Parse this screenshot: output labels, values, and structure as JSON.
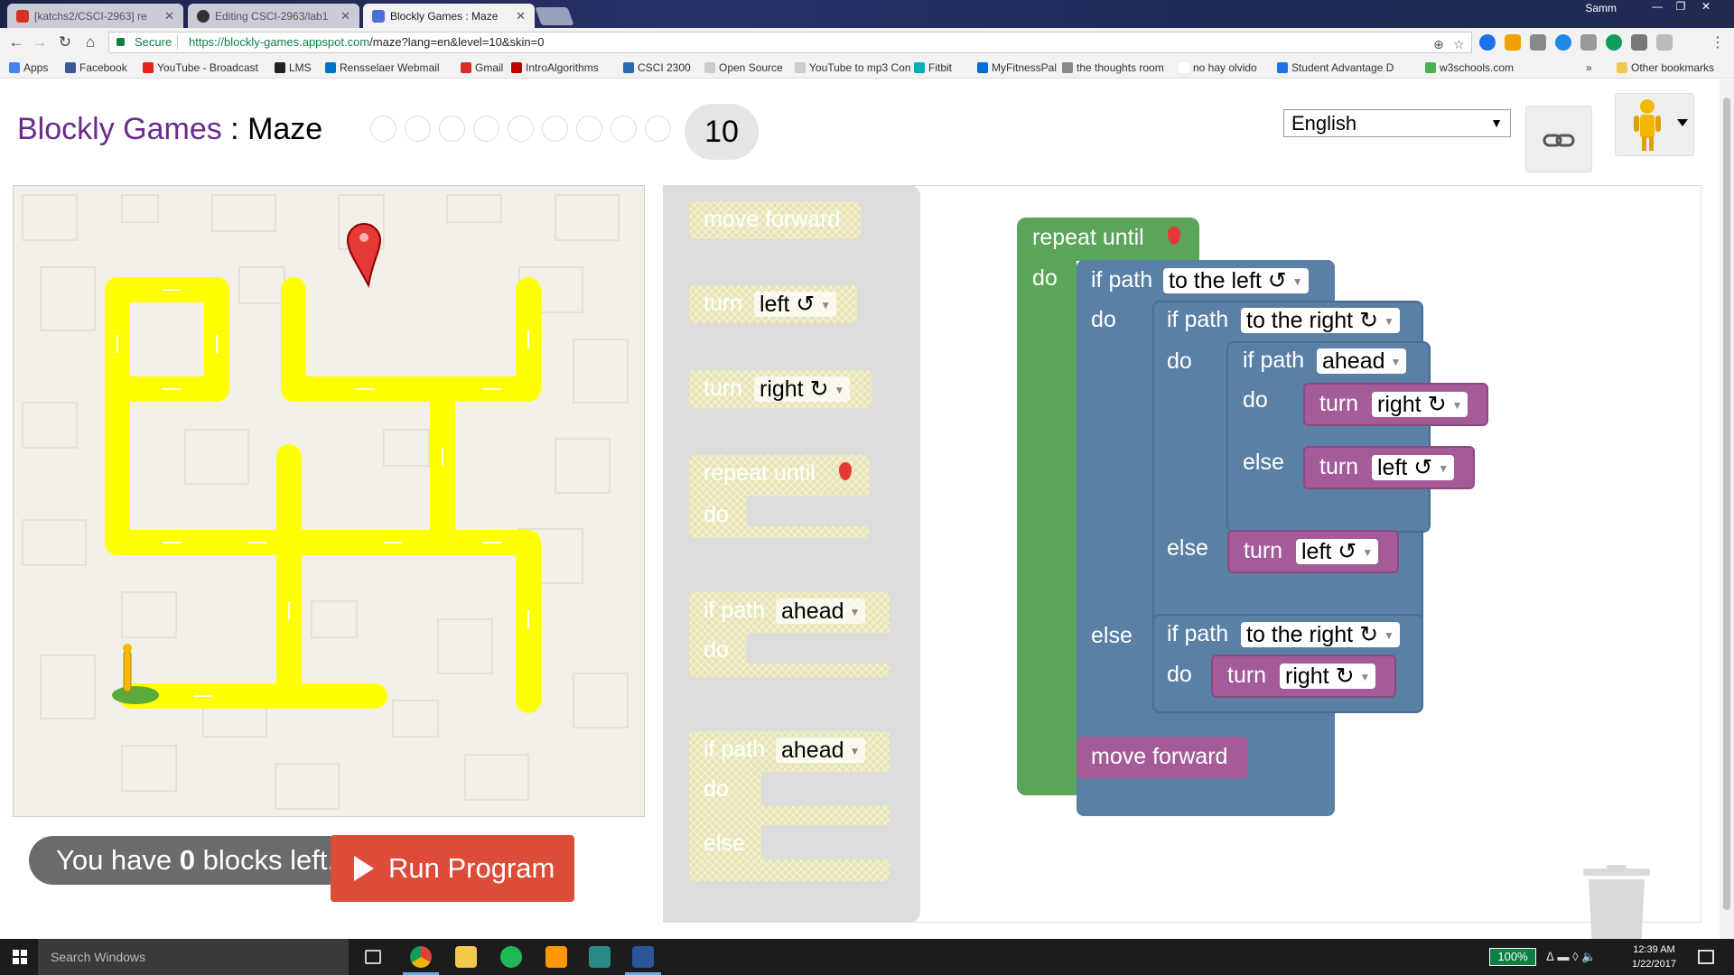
{
  "browser": {
    "tabs": [
      {
        "label": "[katchs2/CSCI-2963] re",
        "active": false
      },
      {
        "label": "Editing CSCI-2963/lab1",
        "active": false
      },
      {
        "label": "Blockly Games : Maze",
        "active": true
      }
    ],
    "user": "Samm",
    "secure_label": "Secure",
    "url_host": "https://blockly-games.appspot.com",
    "url_path": "/maze?lang=en&level=10&skin=0",
    "bookmarks": [
      {
        "label": "Apps",
        "color": "#4285f4"
      },
      {
        "label": "Facebook",
        "color": "#3b5998"
      },
      {
        "label": "YouTube - Broadcast",
        "color": "#e62117"
      },
      {
        "label": "LMS",
        "color": "#222222"
      },
      {
        "label": "Rensselaer Webmail",
        "color": "#0072c6"
      },
      {
        "label": "Gmail",
        "color": "#d93025"
      },
      {
        "label": "IntroAlgorithms",
        "color": "#c00000"
      },
      {
        "label": "CSCI 2300",
        "color": "#2a6bb5"
      },
      {
        "label": "Open Source",
        "color": "#cccccc"
      },
      {
        "label": "YouTube to mp3 Con",
        "color": "#cccccc"
      },
      {
        "label": "Fitbit",
        "color": "#00b0b9"
      },
      {
        "label": "MyFitnessPal",
        "color": "#0070d1"
      },
      {
        "label": "the thoughts room",
        "color": "#888888"
      },
      {
        "label": "no hay olvido",
        "color": "#ffffff"
      },
      {
        "label": "Student Advantage D",
        "color": "#1a73e8"
      },
      {
        "label": "w3schools.com",
        "color": "#4caf50"
      }
    ],
    "more_bookmarks": "»",
    "other_bookmarks": "Other bookmarks"
  },
  "header": {
    "brand": "Blockly Games",
    "separator": " : ",
    "page": "Maze",
    "current_level": "10",
    "language": "English"
  },
  "maze": {
    "blocks_left_prefix": "You have ",
    "blocks_left_count": "0",
    "blocks_left_suffix": " blocks left.",
    "run_label": "Run Program"
  },
  "toolbox": {
    "move_forward": "move forward",
    "turn": "turn",
    "left": "left ↺",
    "right": "right ↻",
    "repeat_until": "repeat until",
    "do": "do",
    "else": "else",
    "if_path": "if path",
    "ahead": "ahead"
  },
  "program": {
    "repeat_until": "repeat until",
    "do": "do",
    "else": "else",
    "if_path": "if path",
    "to_the_left": "to the left ↺",
    "to_the_right": "to the right ↻",
    "ahead": "ahead",
    "turn": "turn",
    "left": "left ↺",
    "right": "right ↻",
    "move_forward": "move forward"
  },
  "taskbar": {
    "search_placeholder": "Search Windows",
    "battery": "100%",
    "time": "12:39 AM",
    "date": "1/22/2017"
  }
}
